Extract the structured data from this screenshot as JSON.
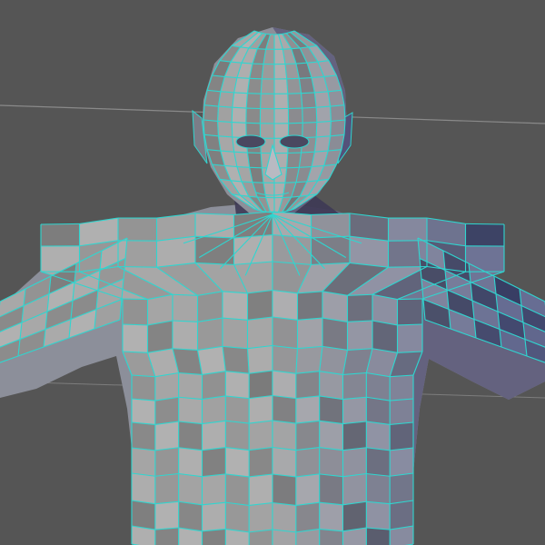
{
  "viewport": {
    "background_color": "#555555",
    "grid_color": "#8a8a8a",
    "wireframe_color": "#2fd6d0",
    "mesh_color_light": "#9ea2ac",
    "mesh_color_dark": "#3a3650",
    "mesh_color_blue": "#4c4a78"
  }
}
